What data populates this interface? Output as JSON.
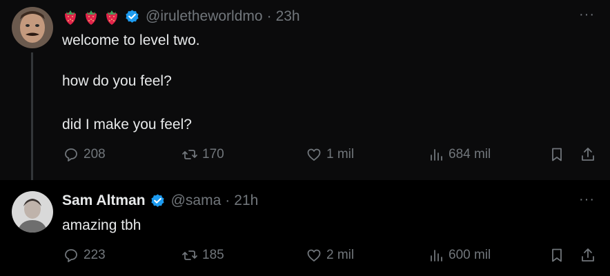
{
  "tweets": [
    {
      "handle": "@iruletheworldmo",
      "time": "23h",
      "emojis": [
        "strawberry",
        "strawberry",
        "strawberry"
      ],
      "verified": true,
      "lines": [
        "welcome to level two.",
        "how do you feel?",
        "did I make you feel?"
      ],
      "stats": {
        "replies": "208",
        "reposts": "170",
        "likes": "1 mil",
        "views": "684 mil"
      }
    },
    {
      "name": "Sam Altman",
      "handle": "@sama",
      "time": "21h",
      "verified": true,
      "lines": [
        "amazing tbh"
      ],
      "stats": {
        "replies": "223",
        "reposts": "185",
        "likes": "2 mil",
        "views": "600 mil"
      }
    }
  ],
  "separator": "·",
  "more_label": "···",
  "colors": {
    "verified": "#1d9bf0",
    "muted": "#71767b",
    "text": "#e7e9ea",
    "background": "#000000"
  },
  "icons": [
    "strawberry-icon",
    "verified-badge-icon",
    "reply-icon",
    "repost-icon",
    "like-icon",
    "views-icon",
    "bookmark-icon",
    "share-icon",
    "more-icon"
  ]
}
